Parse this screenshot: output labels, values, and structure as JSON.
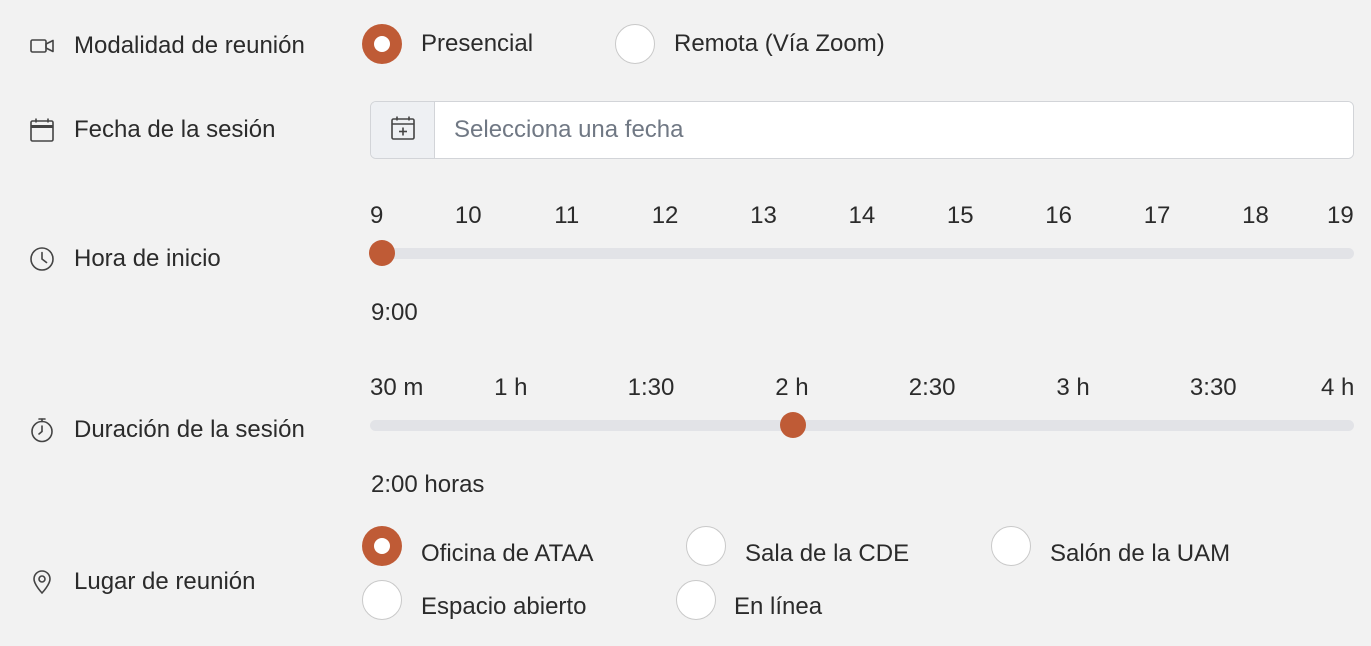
{
  "modalidad": {
    "label": "Modalidad de reunión",
    "icon": "video-camera-icon",
    "options": [
      {
        "label": "Presencial",
        "checked": true
      },
      {
        "label": "Remota (Vía Zoom)",
        "checked": false
      }
    ]
  },
  "fecha": {
    "label": "Fecha de la sesión",
    "icon": "calendar-icon",
    "button_icon": "calendar-plus-icon",
    "placeholder": "Selecciona una fecha",
    "value": ""
  },
  "hora": {
    "label": "Hora de inicio",
    "icon": "clock-icon",
    "ticks": [
      "9",
      "10",
      "11",
      "12",
      "13",
      "14",
      "15",
      "16",
      "17",
      "18",
      "19"
    ],
    "min": 9,
    "max": 19,
    "current": 9,
    "display": "9:00"
  },
  "duracion": {
    "label": "Duración de la sesión",
    "icon": "stopwatch-icon",
    "ticks": [
      "30 m",
      "1 h",
      "1:30",
      "2 h",
      "2:30",
      "3 h",
      "3:30",
      "4 h"
    ],
    "min": 0.5,
    "max": 4,
    "current": 2,
    "display": "2:00 horas"
  },
  "lugar": {
    "label": "Lugar de reunión",
    "icon": "map-pin-icon",
    "options": [
      {
        "label": "Oficina de ATAA",
        "checked": true
      },
      {
        "label": "Sala de la CDE",
        "checked": false
      },
      {
        "label": "Salón de la UAM",
        "checked": false
      },
      {
        "label": "Espacio abierto",
        "checked": false
      },
      {
        "label": "En línea",
        "checked": false
      }
    ]
  },
  "colors": {
    "accent": "#bf5b36",
    "track": "#e2e3e7",
    "background": "#f2f2f2"
  }
}
